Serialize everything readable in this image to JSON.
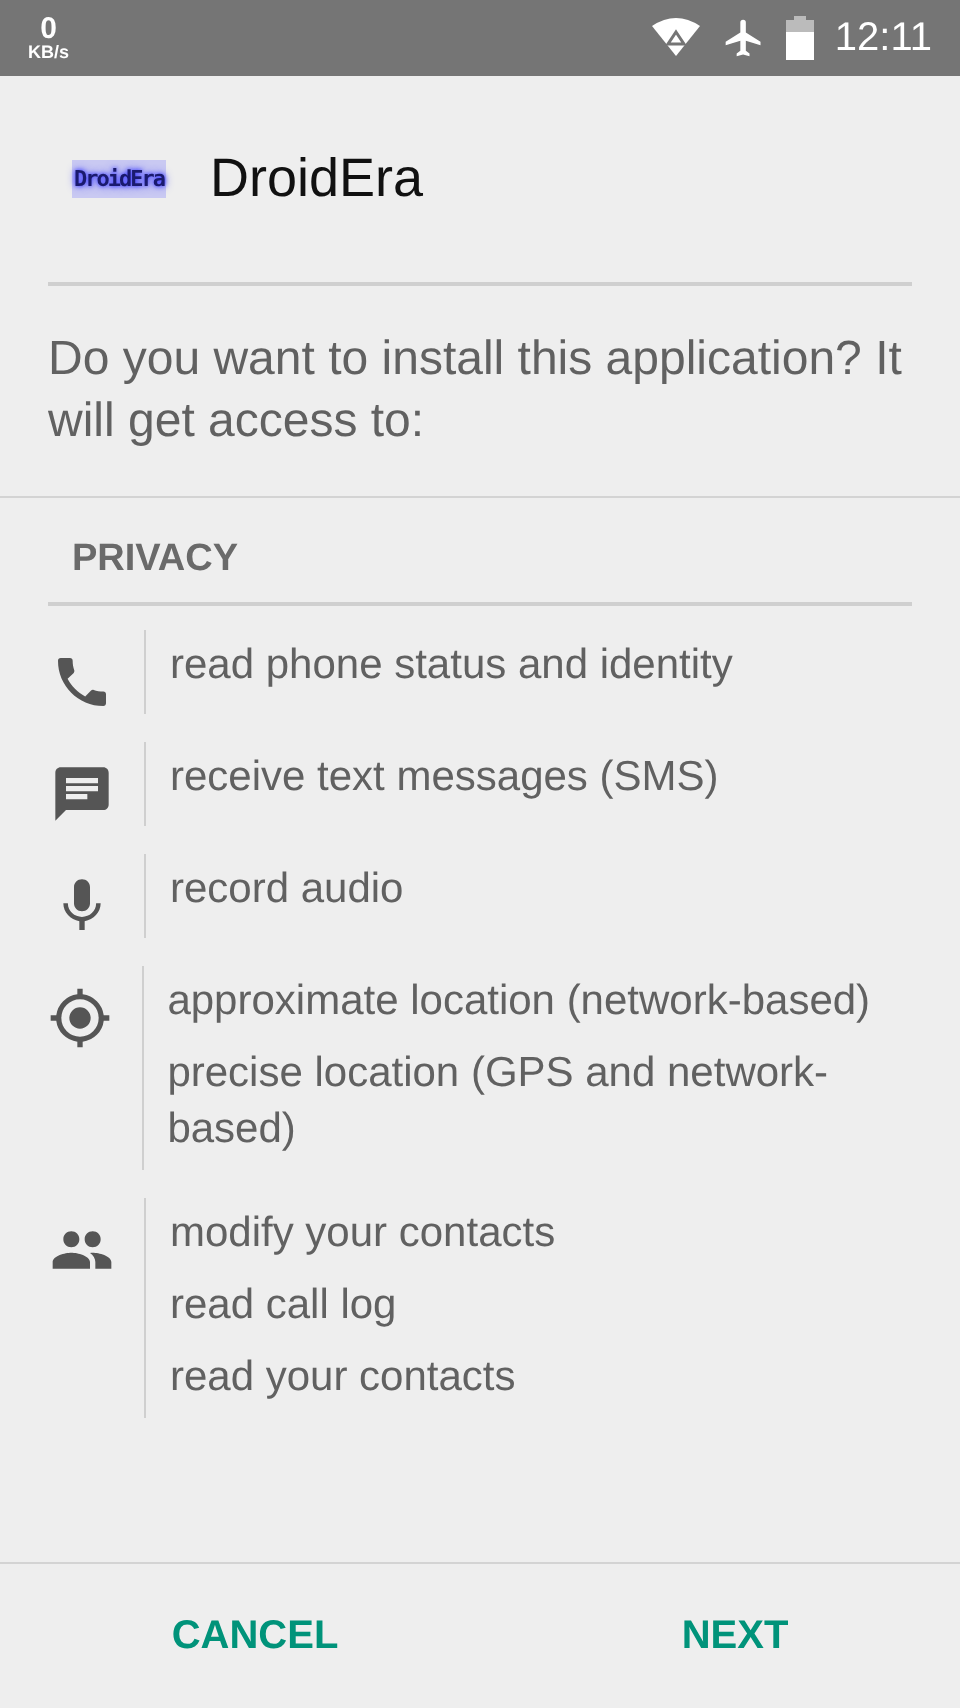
{
  "status_bar": {
    "speed": "0",
    "speed_unit": "KB/s",
    "time": "12:11"
  },
  "app": {
    "logo_text": "DroidEra",
    "name": "DroidEra"
  },
  "prompt": "Do you want to install this application? It will get access to:",
  "section": "PRIVACY",
  "groups": [
    {
      "kind": "phone",
      "items": [
        "read phone status and identity"
      ]
    },
    {
      "kind": "sms",
      "items": [
        "receive text messages (SMS)"
      ]
    },
    {
      "kind": "mic",
      "items": [
        "record audio"
      ]
    },
    {
      "kind": "location",
      "items": [
        "approximate location (network-based)",
        "precise location (GPS and network-based)"
      ]
    },
    {
      "kind": "contacts",
      "items": [
        "modify your contacts",
        "read call log",
        "read your contacts"
      ]
    }
  ],
  "buttons": [
    "CANCEL",
    "NEXT"
  ]
}
